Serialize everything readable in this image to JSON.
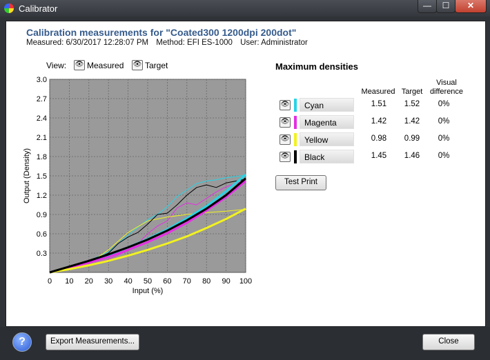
{
  "window": {
    "title": "Calibrator",
    "min_glyph": "—",
    "max_glyph": "☐",
    "close_glyph": "✕"
  },
  "header": {
    "title": "Calibration measurements for \"Coated300 1200dpi  200dot\"",
    "measured": "Measured: 6/30/2017 12:28:07 PM",
    "method": "Method: EFI ES-1000",
    "user": "User: Administrator"
  },
  "view": {
    "label": "View:",
    "measured": "Measured",
    "target": "Target",
    "eye_icon": "eye-icon"
  },
  "densities": {
    "title": "Maximum densities",
    "col_measured": "Measured",
    "col_target": "Target",
    "col_visual_1": "Visual",
    "col_visual_2": "difference",
    "rows": [
      {
        "name": "Cyan",
        "color": "#27d4e6",
        "measured": "1.51",
        "target": "1.52",
        "diff": "0%"
      },
      {
        "name": "Magenta",
        "color": "#e52ee5",
        "measured": "1.42",
        "target": "1.42",
        "diff": "0%"
      },
      {
        "name": "Yellow",
        "color": "#f2f21f",
        "measured": "0.98",
        "target": "0.99",
        "diff": "0%"
      },
      {
        "name": "Black",
        "color": "#000000",
        "measured": "1.45",
        "target": "1.46",
        "diff": "0%"
      }
    ]
  },
  "buttons": {
    "test_print": "Test Print",
    "export": "Export Measurements...",
    "close": "Close",
    "help": "?"
  },
  "chart_data": {
    "type": "line",
    "xlabel": "Input (%)",
    "ylabel": "Output (Density)",
    "xlim": [
      0,
      100
    ],
    "ylim": [
      0,
      3.0
    ],
    "x_ticks": [
      "0",
      "10",
      "20",
      "30",
      "40",
      "50",
      "60",
      "70",
      "80",
      "90",
      "100"
    ],
    "y_ticks": [
      "0.3",
      "0.6",
      "0.9",
      "1.2",
      "1.5",
      "1.8",
      "2.1",
      "2.4",
      "2.7",
      "3.0"
    ],
    "grid": true,
    "background": "#9a9a9a",
    "series": [
      {
        "kind": "target",
        "color": "#27d4e6",
        "x": [
          0,
          10,
          20,
          30,
          40,
          50,
          60,
          70,
          80,
          90,
          100
        ],
        "y": [
          0,
          0.08,
          0.17,
          0.27,
          0.39,
          0.52,
          0.67,
          0.84,
          1.03,
          1.26,
          1.52
        ]
      },
      {
        "kind": "target",
        "color": "#e52ee5",
        "x": [
          0,
          10,
          20,
          30,
          40,
          50,
          60,
          70,
          80,
          90,
          100
        ],
        "y": [
          0,
          0.07,
          0.15,
          0.24,
          0.35,
          0.47,
          0.61,
          0.77,
          0.96,
          1.17,
          1.42
        ]
      },
      {
        "kind": "target",
        "color": "#f2f21f",
        "x": [
          0,
          10,
          20,
          30,
          40,
          50,
          60,
          70,
          80,
          90,
          100
        ],
        "y": [
          0,
          0.05,
          0.11,
          0.18,
          0.26,
          0.35,
          0.45,
          0.56,
          0.69,
          0.83,
          0.99
        ]
      },
      {
        "kind": "target",
        "color": "#000000",
        "x": [
          0,
          10,
          20,
          30,
          40,
          50,
          60,
          70,
          80,
          90,
          100
        ],
        "y": [
          0,
          0.09,
          0.18,
          0.28,
          0.39,
          0.51,
          0.65,
          0.81,
          0.99,
          1.2,
          1.46
        ]
      },
      {
        "kind": "measured",
        "color": "#27d4e6",
        "x": [
          0,
          10,
          20,
          30,
          40,
          50,
          55,
          60,
          65,
          70,
          75,
          80,
          85,
          90,
          95,
          100
        ],
        "y": [
          0,
          0.1,
          0.18,
          0.32,
          0.58,
          0.82,
          0.9,
          1.02,
          1.18,
          1.28,
          1.38,
          1.42,
          1.44,
          1.47,
          1.49,
          1.51
        ]
      },
      {
        "kind": "measured",
        "color": "#e52ee5",
        "x": [
          0,
          10,
          20,
          30,
          40,
          45,
          50,
          55,
          60,
          65,
          70,
          75,
          80,
          85,
          90,
          95,
          100
        ],
        "y": [
          0,
          0.06,
          0.12,
          0.2,
          0.34,
          0.45,
          0.6,
          0.72,
          0.8,
          1.0,
          1.08,
          1.05,
          1.15,
          1.25,
          1.33,
          1.38,
          1.42
        ]
      },
      {
        "kind": "measured",
        "color": "#f2f21f",
        "x": [
          0,
          10,
          20,
          30,
          40,
          50,
          60,
          70,
          80,
          90,
          100
        ],
        "y": [
          0,
          0.04,
          0.14,
          0.35,
          0.62,
          0.8,
          0.86,
          0.9,
          0.93,
          0.95,
          0.98
        ]
      },
      {
        "kind": "measured",
        "color": "#000000",
        "x": [
          0,
          10,
          20,
          30,
          35,
          40,
          45,
          50,
          55,
          60,
          65,
          70,
          75,
          80,
          85,
          90,
          95,
          100
        ],
        "y": [
          0,
          0.08,
          0.16,
          0.3,
          0.45,
          0.55,
          0.62,
          0.75,
          0.9,
          0.92,
          1.05,
          1.2,
          1.32,
          1.36,
          1.32,
          1.39,
          1.42,
          1.45
        ]
      }
    ]
  }
}
